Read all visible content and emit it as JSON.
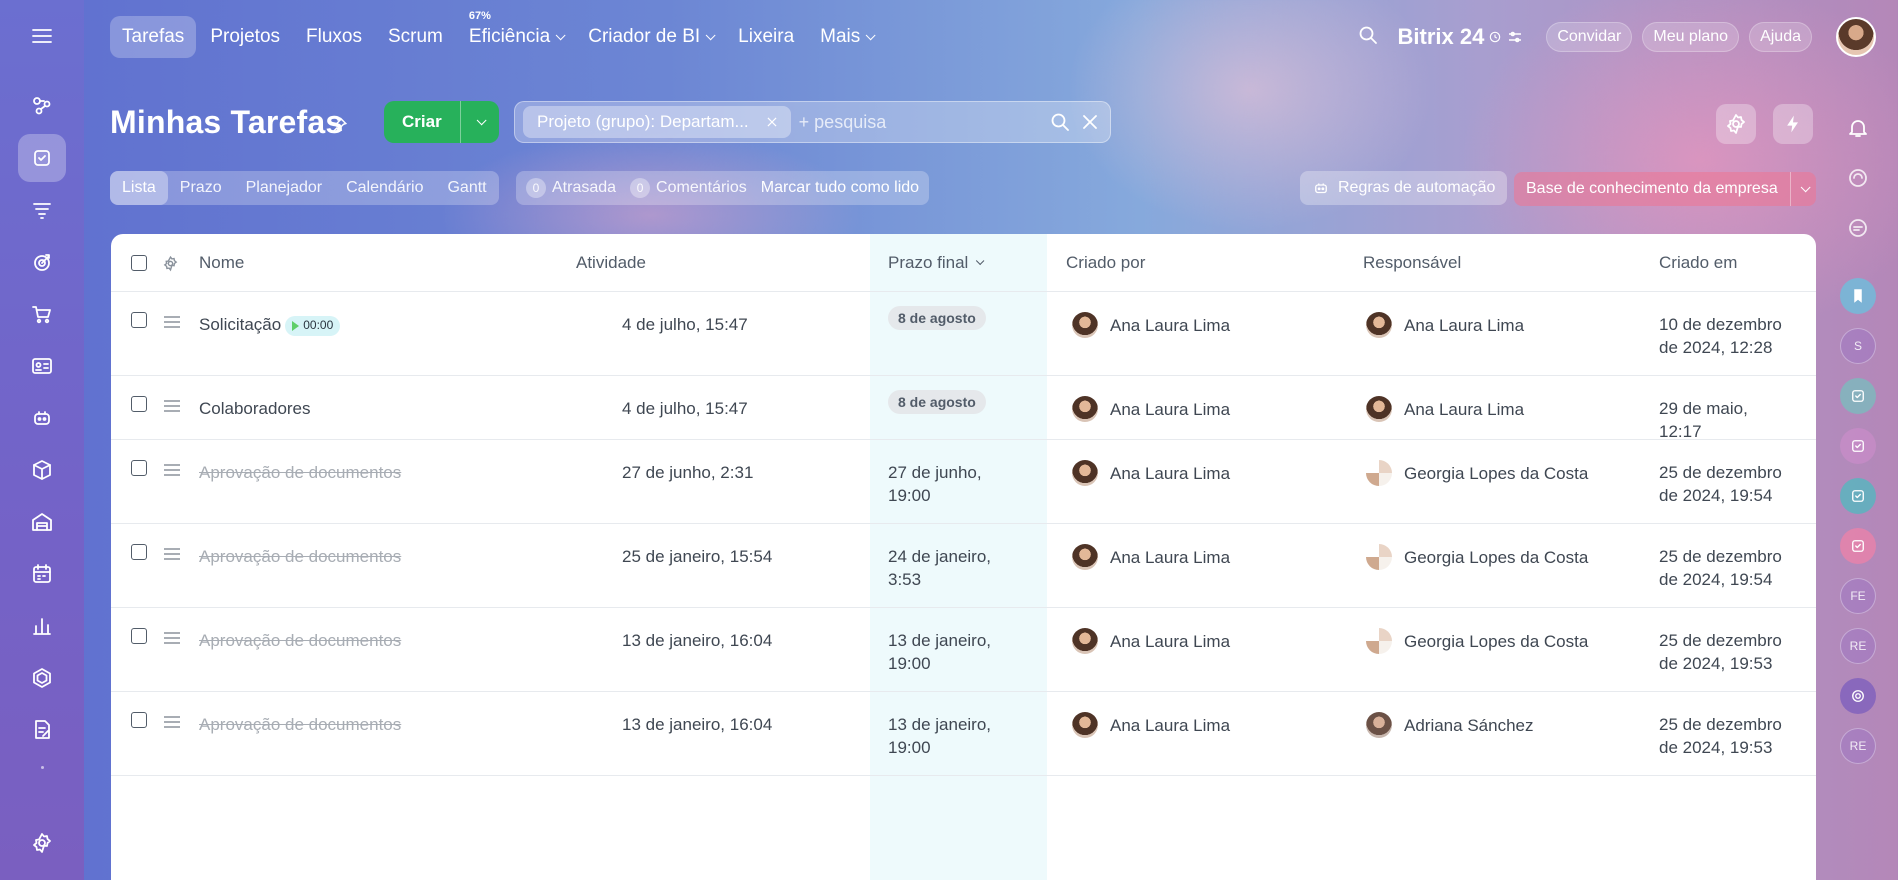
{
  "nav": {
    "items": [
      {
        "label": "Tarefas",
        "active": true,
        "dropdown": false,
        "sup": ""
      },
      {
        "label": "Projetos",
        "active": false,
        "dropdown": false,
        "sup": ""
      },
      {
        "label": "Fluxos",
        "active": false,
        "dropdown": false,
        "sup": ""
      },
      {
        "label": "Scrum",
        "active": false,
        "dropdown": false,
        "sup": ""
      },
      {
        "label": "Eficiência",
        "active": false,
        "dropdown": true,
        "sup": "67%"
      },
      {
        "label": "Criador de BI",
        "active": false,
        "dropdown": true,
        "sup": ""
      },
      {
        "label": "Lixeira",
        "active": false,
        "dropdown": false,
        "sup": ""
      },
      {
        "label": "Mais",
        "active": false,
        "dropdown": true,
        "sup": ""
      }
    ]
  },
  "header": {
    "brand": "Bitrix 24",
    "invite": "Convidar",
    "plan": "Meu plano",
    "help": "Ajuda"
  },
  "page": {
    "title": "Minhas Tarefas",
    "create_label": "Criar",
    "filter_chip": "Projeto (grupo): Departam...",
    "search_placeholder": "+ pesquisa"
  },
  "views": {
    "tabs": [
      "Lista",
      "Prazo",
      "Planejador",
      "Calendário",
      "Gantt"
    ],
    "active": "Lista"
  },
  "counters": {
    "overdue_count": "0",
    "overdue_label": "Atrasada",
    "comments_count": "0",
    "comments_label": "Comentários",
    "mark_all": "Marcar tudo como lido"
  },
  "actions": {
    "automation": "Regras de automação",
    "knowledge_base": "Base de conhecimento da empresa"
  },
  "table": {
    "columns": {
      "name": "Nome",
      "activity": "Atividade",
      "deadline": "Prazo final",
      "created_by": "Criado por",
      "responsible": "Responsável",
      "created_on": "Criado em"
    },
    "rows": [
      {
        "name": "Solicitação",
        "timer": "00:00",
        "done": false,
        "activity": "4 de julho, 15:47",
        "deadline": "8 de agosto",
        "deadline_pill": true,
        "creator": "Ana Laura Lima",
        "responsible": "Ana Laura Lima",
        "responsible_avatar": "ana",
        "created": "10 de dezembro de 2024, 12:28"
      },
      {
        "name": "Colaboradores",
        "timer": "",
        "done": false,
        "activity": "4 de julho, 15:47",
        "deadline": "8 de agosto",
        "deadline_pill": true,
        "creator": "Ana Laura Lima",
        "responsible": "Ana Laura Lima",
        "responsible_avatar": "ana",
        "created": "29 de maio, 12:17"
      },
      {
        "name": "Aprovação de documentos",
        "timer": "",
        "done": true,
        "activity": "27 de junho, 2:31",
        "deadline": "27 de junho, 19:00",
        "deadline_pill": false,
        "creator": "Ana Laura Lima",
        "responsible": "Georgia Lopes da Costa",
        "responsible_avatar": "georgia",
        "created": "25 de dezembro de 2024, 19:54"
      },
      {
        "name": "Aprovação de documentos",
        "timer": "",
        "done": true,
        "activity": "25 de janeiro, 15:54",
        "deadline": "24 de janeiro, 3:53",
        "deadline_pill": false,
        "creator": "Ana Laura Lima",
        "responsible": "Georgia Lopes da Costa",
        "responsible_avatar": "georgia",
        "created": "25 de dezembro de 2024, 19:54"
      },
      {
        "name": "Aprovação de documentos",
        "timer": "",
        "done": true,
        "activity": "13 de janeiro, 16:04",
        "deadline": "13 de janeiro, 19:00",
        "deadline_pill": false,
        "creator": "Ana Laura Lima",
        "responsible": "Georgia Lopes da Costa",
        "responsible_avatar": "georgia",
        "created": "25 de dezembro de 2024, 19:53"
      },
      {
        "name": "Aprovação de documentos",
        "timer": "",
        "done": true,
        "activity": "13 de janeiro, 16:04",
        "deadline": "13 de janeiro, 19:00",
        "deadline_pill": false,
        "creator": "Ana Laura Lima",
        "responsible": "Adriana Sánchez",
        "responsible_avatar": "adriana",
        "created": "25 de dezembro de 2024, 19:53"
      }
    ]
  },
  "right_bar": {
    "badges": [
      "S",
      "FE",
      "RE",
      "RE"
    ]
  },
  "colors": {
    "create_button": "#27b15b",
    "deadline_column": "#eefafc",
    "knowledge_base_button": "#eb7896"
  }
}
